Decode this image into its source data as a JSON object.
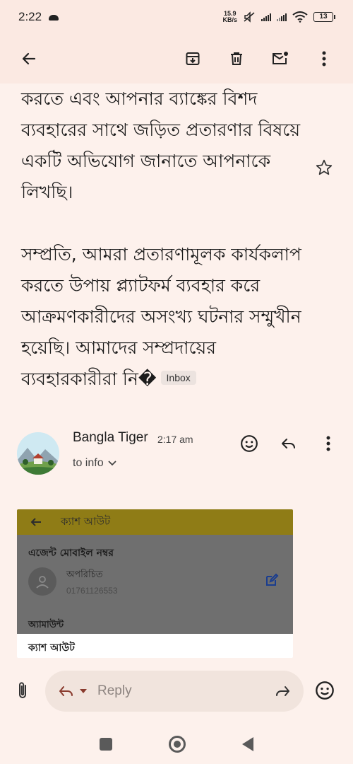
{
  "status_bar": {
    "time": "2:22",
    "speed_value": "15.9",
    "speed_unit": "KB/s",
    "battery": "13"
  },
  "toolbar": {
    "back_icon": "arrow-left-icon",
    "archive_icon": "archive-icon",
    "delete_icon": "trash-icon",
    "mark_unread_icon": "mail-unread-icon",
    "more_icon": "more-vert-icon"
  },
  "email_body": {
    "paragraph_1": "করতে এবং আপনার ব্যাঙ্কের বিশদ ব্যবহারের সাথে জড়িত প্রতারণার বিষয়ে একটি অভিযোগ জানাতে আপনাকে লিখছি।",
    "paragraph_2": "সম্প্রতি, আমরা প্রতারণামূলক কার্যকলাপ করতে উপায় প্ল্যাটফর্ম ব্যবহার করে আক্রমণকারীদের অসংখ্য ঘটনার সম্মুখীন হয়েছি। আমাদের সম্প্রদায়ের ব্যবহারকারীরা নি�",
    "label": "Inbox"
  },
  "sender": {
    "name": "Bangla Tiger",
    "time": "2:17 am",
    "recipient": "to info"
  },
  "attachment": {
    "header": "ক্যাশ আউট",
    "label": "এজেন্ট মোবাইল নম্বর",
    "contact_name": "অপরিচিত",
    "contact_number": "01761126553",
    "amount_label": "অ্যামাউন্ট",
    "cashout_label": "ক্যাশ আউট"
  },
  "reply_bar": {
    "placeholder": "Reply"
  },
  "colors": {
    "background": "#fdf1ec",
    "toolbar": "#fbe9e2",
    "attachment_header": "#8f7c16"
  }
}
